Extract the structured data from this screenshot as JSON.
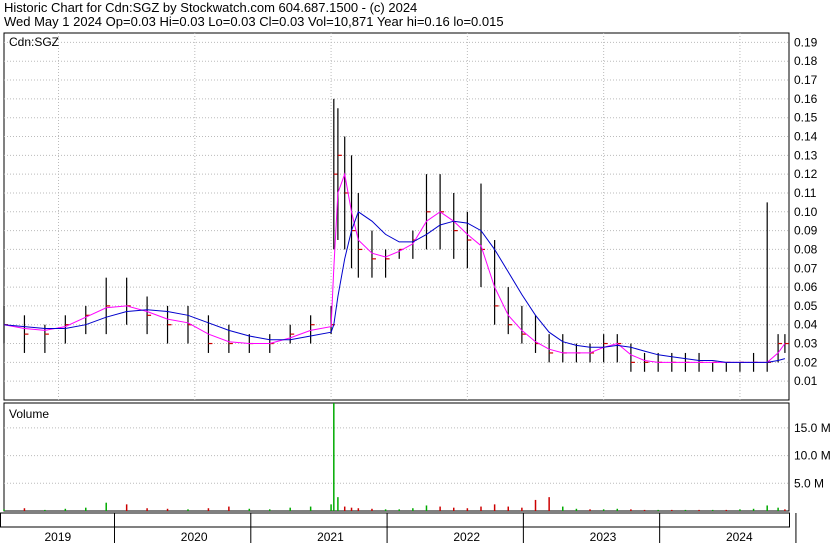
{
  "header": {
    "line1": "Historic Chart for Cdn:SGZ by Stockwatch.com 604.687.1500 - (c) 2024",
    "line2": "Wed May  1 2024   Op=0.03  Hi=0.03  Lo=0.03  Cl=0.03  Vol=10,871  Year hi=0.16  lo=0.015"
  },
  "chart_data": {
    "type": "bar",
    "title": "Cdn:SGZ",
    "price_panel": {
      "label": "Cdn:SGZ",
      "ylim": [
        0.0,
        0.195
      ],
      "yticks": [
        "0.19",
        "0.18",
        "0.17",
        "0.16",
        "0.15",
        "0.14",
        "0.13",
        "0.12",
        "0.11",
        "0.10",
        "0.09",
        "0.08",
        "0.07",
        "0.06",
        "0.05",
        "0.04",
        "0.03",
        "0.02",
        "0.01"
      ],
      "grid": true,
      "x": [
        2018.6,
        2018.75,
        2018.9,
        2019.05,
        2019.2,
        2019.35,
        2019.5,
        2019.65,
        2019.8,
        2019.95,
        2020.1,
        2020.25,
        2020.4,
        2020.55,
        2020.7,
        2020.85,
        2021.0,
        2021.02,
        2021.05,
        2021.1,
        2021.15,
        2021.2,
        2021.3,
        2021.4,
        2021.5,
        2021.6,
        2021.7,
        2021.8,
        2021.9,
        2022.0,
        2022.1,
        2022.2,
        2022.3,
        2022.4,
        2022.5,
        2022.6,
        2022.7,
        2022.8,
        2022.9,
        2023.0,
        2023.1,
        2023.2,
        2023.3,
        2023.4,
        2023.5,
        2023.6,
        2023.7,
        2023.8,
        2023.9,
        2024.0,
        2024.1,
        2024.2,
        2024.28,
        2024.33
      ],
      "series": [
        {
          "name": "price",
          "color": "#000000",
          "high": [
            0.05,
            0.045,
            0.04,
            0.045,
            0.05,
            0.065,
            0.065,
            0.055,
            0.05,
            0.05,
            0.045,
            0.04,
            0.035,
            0.035,
            0.04,
            0.045,
            0.05,
            0.16,
            0.155,
            0.14,
            0.13,
            0.11,
            0.09,
            0.08,
            0.08,
            0.09,
            0.12,
            0.12,
            0.11,
            0.1,
            0.115,
            0.085,
            0.06,
            0.05,
            0.045,
            0.035,
            0.035,
            0.03,
            0.03,
            0.035,
            0.035,
            0.03,
            0.025,
            0.025,
            0.025,
            0.025,
            0.025,
            0.02,
            0.02,
            0.02,
            0.025,
            0.105,
            0.035,
            0.035
          ],
          "low": [
            0.03,
            0.025,
            0.025,
            0.03,
            0.035,
            0.035,
            0.04,
            0.035,
            0.03,
            0.03,
            0.025,
            0.025,
            0.025,
            0.025,
            0.03,
            0.03,
            0.035,
            0.08,
            0.085,
            0.08,
            0.07,
            0.065,
            0.065,
            0.065,
            0.075,
            0.075,
            0.08,
            0.08,
            0.075,
            0.07,
            0.06,
            0.04,
            0.035,
            0.03,
            0.025,
            0.02,
            0.02,
            0.02,
            0.02,
            0.02,
            0.02,
            0.015,
            0.015,
            0.015,
            0.015,
            0.015,
            0.015,
            0.015,
            0.015,
            0.015,
            0.015,
            0.015,
            0.02,
            0.025
          ],
          "close": [
            0.04,
            0.035,
            0.035,
            0.04,
            0.045,
            0.05,
            0.05,
            0.045,
            0.04,
            0.04,
            0.03,
            0.03,
            0.03,
            0.03,
            0.035,
            0.04,
            0.04,
            0.12,
            0.13,
            0.11,
            0.09,
            0.08,
            0.075,
            0.075,
            0.08,
            0.085,
            0.1,
            0.1,
            0.09,
            0.085,
            0.08,
            0.05,
            0.04,
            0.035,
            0.03,
            0.025,
            0.025,
            0.025,
            0.025,
            0.03,
            0.03,
            0.02,
            0.02,
            0.02,
            0.02,
            0.02,
            0.02,
            0.02,
            0.02,
            0.02,
            0.02,
            0.02,
            0.03,
            0.03
          ]
        },
        {
          "name": "ma_short",
          "color": "#ff00ff",
          "values": [
            0.04,
            0.038,
            0.037,
            0.039,
            0.044,
            0.049,
            0.05,
            0.047,
            0.043,
            0.041,
            0.035,
            0.031,
            0.03,
            0.03,
            0.033,
            0.037,
            0.039,
            0.07,
            0.11,
            0.12,
            0.1,
            0.085,
            0.078,
            0.076,
            0.079,
            0.083,
            0.095,
            0.1,
            0.095,
            0.088,
            0.082,
            0.06,
            0.045,
            0.037,
            0.031,
            0.027,
            0.025,
            0.025,
            0.025,
            0.028,
            0.03,
            0.024,
            0.021,
            0.02,
            0.02,
            0.02,
            0.02,
            0.02,
            0.02,
            0.02,
            0.02,
            0.02,
            0.025,
            0.03
          ]
        },
        {
          "name": "ma_long",
          "color": "#0000cc",
          "values": [
            0.04,
            0.039,
            0.038,
            0.038,
            0.04,
            0.044,
            0.047,
            0.048,
            0.047,
            0.045,
            0.041,
            0.037,
            0.034,
            0.032,
            0.032,
            0.034,
            0.036,
            0.04,
            0.055,
            0.075,
            0.09,
            0.1,
            0.095,
            0.088,
            0.084,
            0.084,
            0.088,
            0.093,
            0.095,
            0.094,
            0.09,
            0.08,
            0.068,
            0.056,
            0.045,
            0.036,
            0.031,
            0.029,
            0.028,
            0.028,
            0.029,
            0.028,
            0.026,
            0.024,
            0.023,
            0.022,
            0.021,
            0.021,
            0.02,
            0.02,
            0.02,
            0.02,
            0.021,
            0.022
          ]
        }
      ]
    },
    "volume_panel": {
      "label": "Volume",
      "ylim": [
        0,
        19.5
      ],
      "yticks": [
        "15.0 M",
        "10.0 M",
        "5.0 M"
      ],
      "values_m": [
        0.3,
        0.5,
        0.2,
        0.4,
        0.6,
        1.5,
        1.2,
        0.5,
        0.4,
        0.3,
        0.5,
        0.8,
        0.4,
        0.3,
        0.6,
        0.8,
        1.2,
        19.5,
        2.5,
        0.8,
        0.6,
        0.5,
        0.4,
        0.3,
        0.3,
        0.5,
        1.0,
        0.8,
        0.6,
        0.5,
        0.8,
        1.2,
        0.8,
        0.6,
        2.0,
        2.5,
        0.8,
        0.4,
        0.3,
        0.3,
        0.4,
        0.3,
        0.2,
        0.2,
        0.2,
        0.2,
        0.2,
        0.2,
        0.2,
        0.3,
        0.4,
        1.0,
        0.6,
        0.3
      ],
      "up_flags": [
        1,
        0,
        1,
        1,
        1,
        1,
        0,
        0,
        0,
        1,
        0,
        0,
        1,
        1,
        1,
        1,
        1,
        1,
        1,
        0,
        0,
        0,
        0,
        1,
        1,
        1,
        1,
        0,
        0,
        0,
        0,
        0,
        0,
        0,
        0,
        0,
        1,
        1,
        0,
        1,
        1,
        0,
        0,
        1,
        0,
        1,
        0,
        1,
        0,
        1,
        1,
        1,
        1,
        0
      ],
      "up_color": "#00aa00",
      "down_color": "#cc0000"
    },
    "x_axis": {
      "labels": [
        "2019",
        "2020",
        "2021",
        "2022",
        "2023",
        "2024"
      ],
      "label_x": [
        2019.0,
        2020.0,
        2021.0,
        2022.0,
        2023.0,
        2024.0
      ],
      "xlim": [
        2018.6,
        2024.36
      ]
    }
  }
}
